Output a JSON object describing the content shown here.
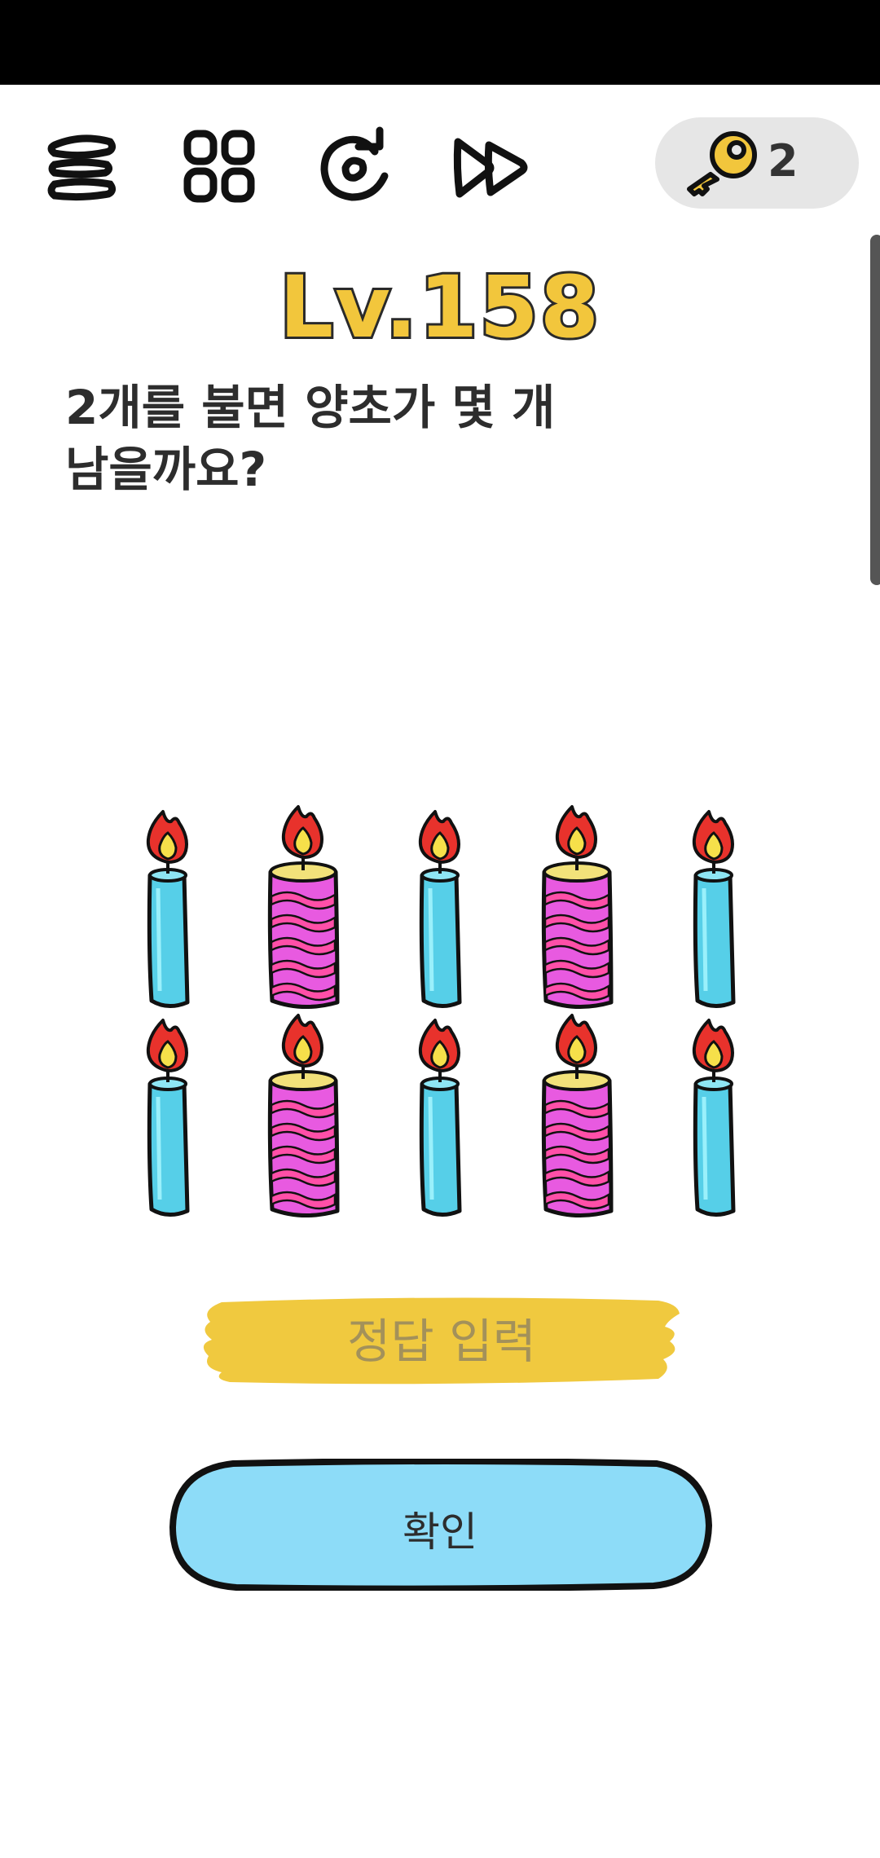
{
  "toolbar": {
    "items": [
      {
        "name": "menu",
        "icon": "menu-icon"
      },
      {
        "name": "level-select",
        "icon": "grid-icon"
      },
      {
        "name": "restart",
        "icon": "refresh-icon"
      },
      {
        "name": "skip",
        "icon": "fast-forward-icon"
      }
    ],
    "key_count": "2",
    "key_icon": "key-icon"
  },
  "level": {
    "title": "Lv.158"
  },
  "question": {
    "text": "2개를 불면 양초가 몇 개\n남을까요?"
  },
  "puzzle": {
    "candle_rows": [
      [
        "blue",
        "pink",
        "blue",
        "pink",
        "blue"
      ],
      [
        "blue",
        "pink",
        "blue",
        "pink",
        "blue"
      ]
    ],
    "colors": {
      "blue": "#56cfe8",
      "pink": "#e85ae0",
      "pink_stripe": "#ff4fa8",
      "flame_outer": "#e8322c",
      "flame_inner": "#f6e04a",
      "wax_top": "#f2e27a"
    }
  },
  "answer": {
    "placeholder": "정답 입력",
    "value": "",
    "color": "#f0c93f"
  },
  "confirm": {
    "label": "확인",
    "color": "#8ddcf8"
  }
}
